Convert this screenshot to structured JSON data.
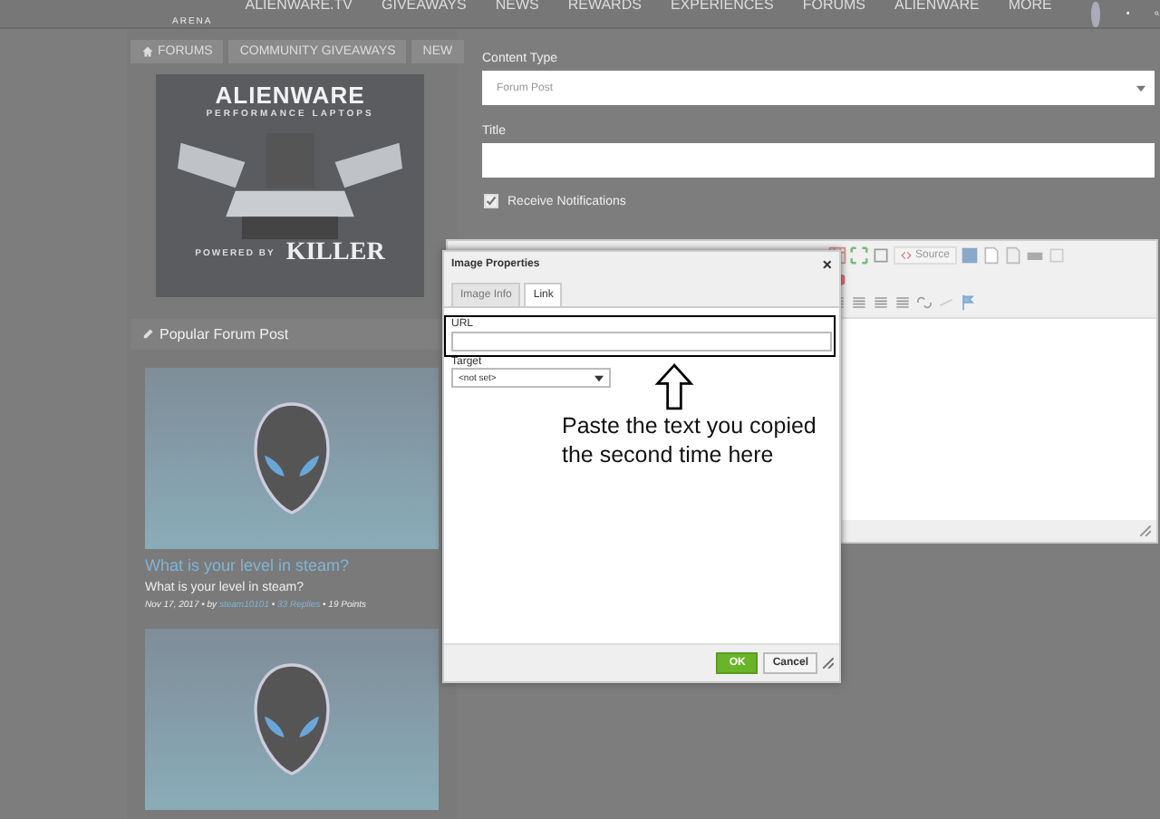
{
  "top_bar": {
    "logo": "ARENA",
    "nav": [
      "ALIENWARE.TV",
      "GIVEAWAYS",
      "NEWS",
      "REWARDS",
      "EXPERIENCES",
      "FORUMS",
      "ALIENWARE",
      "MORE"
    ]
  },
  "breadcrumb": [
    {
      "label": "FORUMS"
    },
    {
      "label": "COMMUNITY GIVEAWAYS"
    },
    {
      "label": "NEW"
    }
  ],
  "ad": {
    "brand": "ALIENWARE",
    "tagline": "PERFORMANCE LAPTOPS",
    "powered_by": "POWERED BY",
    "partner": "KILLER"
  },
  "popular": {
    "heading": "Popular Forum Post",
    "posts": [
      {
        "kind": "full",
        "title": "What is your level in steam?",
        "summary": "What is your level in steam?",
        "date": "Nov 17, 2017 • by ",
        "author": "steam10101",
        "sep": " • ",
        "replies": "33 Replies",
        "points": " • 19 Points"
      },
      {
        "kind": "image"
      }
    ]
  },
  "form": {
    "content_type_label": "Content Type",
    "content_type_value": "Forum Post",
    "title_label": "Title",
    "notify_label": "Receive Notifications",
    "notify_checked": true,
    "source_button": "Source"
  },
  "dialog": {
    "title": "Image Properties",
    "close": "×",
    "tabs": [
      {
        "label": "Image Info",
        "selected": false
      },
      {
        "label": "Link",
        "selected": true
      }
    ],
    "url_label": "URL",
    "target_label": "Target",
    "target_value": "<not set>",
    "ok": "OK",
    "cancel": "Cancel"
  },
  "annotation": {
    "text": "Paste the text you copied the second time here"
  }
}
